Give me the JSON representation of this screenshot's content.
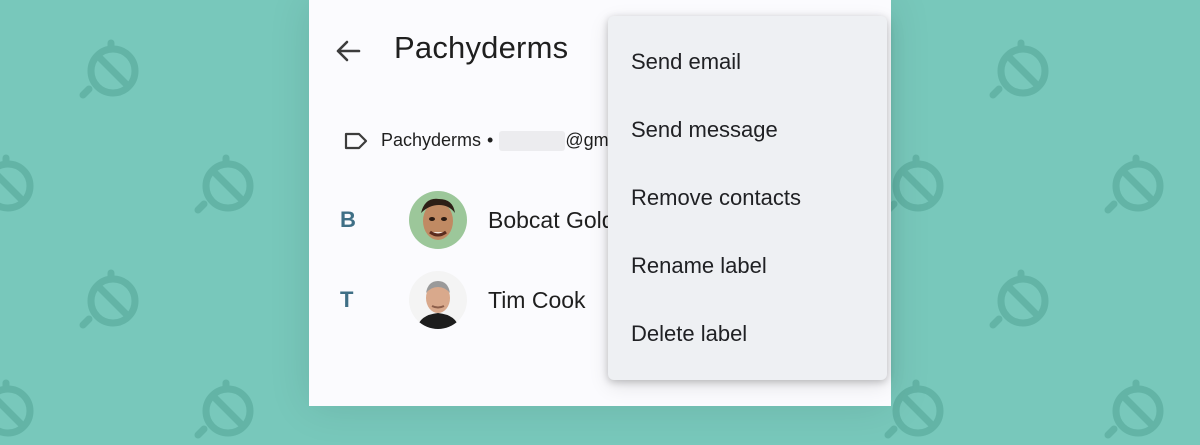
{
  "header": {
    "title": "Pachyderms"
  },
  "label_row": {
    "label_name": "Pachyderms",
    "separator": "•",
    "email_visible": "@gm"
  },
  "contacts": [
    {
      "section_letter": "B",
      "name": "Bobcat Gold"
    },
    {
      "section_letter": "T",
      "name": "Tim Cook"
    }
  ],
  "menu": {
    "items": [
      {
        "label": "Send email"
      },
      {
        "label": "Send message"
      },
      {
        "label": "Remove contacts"
      },
      {
        "label": "Rename label"
      },
      {
        "label": "Delete label"
      }
    ]
  },
  "colors": {
    "background": "#78c8bb",
    "pattern": "#63b4a6",
    "panel": "#fbfbfe",
    "menu": "#eef0f3",
    "section_letter": "#3f6f86"
  }
}
